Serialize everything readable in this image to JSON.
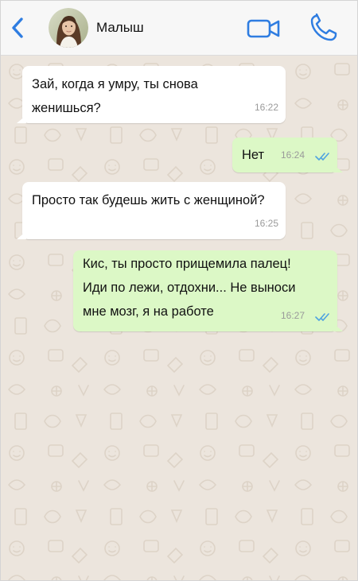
{
  "header": {
    "contact_name": "Малыш",
    "back_icon": "chevron-left-icon",
    "video_icon": "video-camera-icon",
    "call_icon": "phone-icon",
    "accent_color": "#2f7de1"
  },
  "chat": {
    "background_color": "#ece5dd",
    "incoming_bubble_color": "#ffffff",
    "outgoing_bubble_color": "#dcf8c6",
    "read_tick_color": "#4fa3e0",
    "messages": [
      {
        "direction": "incoming",
        "lines": [
          "Зай, когда я умру, ты снова",
          "женишься?"
        ],
        "time": "16:22"
      },
      {
        "direction": "outgoing",
        "lines": [
          "Нет"
        ],
        "time": "16:24",
        "status": "read"
      },
      {
        "direction": "incoming",
        "lines": [
          "Просто так будешь жить с женщиной?"
        ],
        "time": "16:25"
      },
      {
        "direction": "outgoing",
        "lines": [
          "Кис, ты просто прищемила палец!",
          "Иди по лежи, отдохни... Не выноси",
          "мне мозг, я на работе"
        ],
        "time": "16:27",
        "status": "read"
      }
    ]
  }
}
